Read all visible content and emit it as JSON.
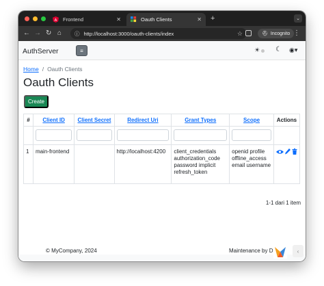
{
  "browser": {
    "tabs": [
      {
        "title": "Frontend",
        "icon": "angular-icon",
        "active": false
      },
      {
        "title": "Oauth Clients",
        "icon": "app-icon",
        "active": true
      }
    ],
    "new_tab": "+",
    "url": "http://localhost:3000/oauth-clients/index",
    "incognito_label": "Incognito",
    "colors": {
      "tab_strip": "#1f1f1f",
      "toolbar": "#353535"
    }
  },
  "app": {
    "brand": "AuthServer",
    "toggler_icon": "≡",
    "theme_sun": "☀",
    "theme_moon": "☾",
    "user_icon": "◉▾"
  },
  "breadcrumb": {
    "home": "Home",
    "separator": "/",
    "current": "Oauth Clients"
  },
  "page": {
    "title": "Oauth Clients",
    "create_label": "Create",
    "accent": "#198754",
    "link_color": "#0d6efd"
  },
  "table": {
    "headers": {
      "index": "#",
      "client_id": "Client ID",
      "client_secret": "Client Secret",
      "redirect_uri": "Redirect Uri",
      "grant_types": "Grant Types",
      "scope": "Scope",
      "actions": "Actions"
    },
    "rows": [
      {
        "index": "1",
        "client_id": "main-frontend",
        "client_secret": "",
        "redirect_uri": "http://localhost:4200",
        "grant_types": [
          "client_credentials",
          "authorization_code",
          "password implicit",
          "refresh_token"
        ],
        "scope": [
          "openid profile",
          "offline_access",
          "email username"
        ]
      }
    ],
    "pagination": "1-1 dari 1 item"
  },
  "footer": {
    "copyright": "© MyCompany, 2024",
    "right": "Maintenance by D"
  }
}
